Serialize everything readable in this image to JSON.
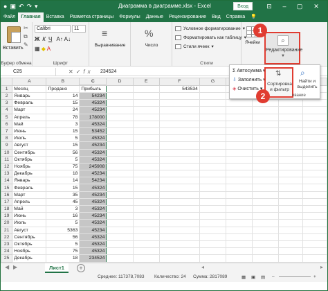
{
  "window": {
    "title": "Диаграмма в диаграмме.xlsx - Excel",
    "login": "Вход",
    "accent": "#217346",
    "highlight": "#e03c31"
  },
  "tabs": [
    "Файл",
    "Главная",
    "Вставка",
    "Разметка страницы",
    "Формулы",
    "Данные",
    "Рецензирование",
    "Вид",
    "Справка"
  ],
  "ribbon": {
    "paste_label": "Вставить",
    "clipboard_caption": "Буфер обмена",
    "font_name": "Calibri",
    "font_size": "11",
    "font_caption": "Шрифт",
    "align_label": "Выравнивание",
    "number_label": "Число",
    "cond_format": "Условное форматирование",
    "format_table": "Форматировать как таблицу",
    "cell_styles": "Стили ячеек",
    "styles_caption": "Стили",
    "cells_label": "Ячейки",
    "edit_label": "Редактирование"
  },
  "dropdown": {
    "autosum": "Автосумма",
    "fill": "Заполнить",
    "clear": "Очистить",
    "sort_filter": "Сортировка и фильтр",
    "find_select": "Найти и выделить",
    "caption": "ование"
  },
  "badges": [
    "1",
    "2"
  ],
  "formula_bar": {
    "name_box": "C25",
    "fx": "fx",
    "value": "234524"
  },
  "columns": [
    "A",
    "B",
    "C",
    "D",
    "E",
    "F",
    "G",
    "H",
    "I",
    "J",
    "K"
  ],
  "rows": [
    {
      "n": "1",
      "a": "Месяц",
      "b": "Продано",
      "c": "Прибыль",
      "f": "543534"
    },
    {
      "n": "2",
      "a": "Январь",
      "b": "14",
      "c": "54234"
    },
    {
      "n": "3",
      "a": "Февраль",
      "b": "15",
      "c": "45324"
    },
    {
      "n": "4",
      "a": "Март",
      "b": "24",
      "c": "45234"
    },
    {
      "n": "5",
      "a": "Апрель",
      "b": "78",
      "c": "178000"
    },
    {
      "n": "6",
      "a": "Май",
      "b": "3",
      "c": "45324"
    },
    {
      "n": "7",
      "a": "Июнь",
      "b": "15",
      "c": "53452"
    },
    {
      "n": "8",
      "a": "Июль",
      "b": "5",
      "c": "45324"
    },
    {
      "n": "9",
      "a": "Август",
      "b": "15",
      "c": "45234"
    },
    {
      "n": "10",
      "a": "Сентябрь",
      "b": "56",
      "c": "45324"
    },
    {
      "n": "11",
      "a": "Октябрь",
      "b": "5",
      "c": "45324"
    },
    {
      "n": "12",
      "a": "Ноябрь",
      "b": "75",
      "c": "245908"
    },
    {
      "n": "13",
      "a": "Декабрь",
      "b": "18",
      "c": "45234"
    },
    {
      "n": "14",
      "a": "Январь",
      "b": "14",
      "c": "54234"
    },
    {
      "n": "15",
      "a": "Февраль",
      "b": "15",
      "c": "45324"
    },
    {
      "n": "16",
      "a": "Март",
      "b": "35",
      "c": "45234"
    },
    {
      "n": "17",
      "a": "Апрель",
      "b": "45",
      "c": "45324"
    },
    {
      "n": "18",
      "a": "Май",
      "b": "3",
      "c": "45324"
    },
    {
      "n": "19",
      "a": "Июнь",
      "b": "16",
      "c": "45234"
    },
    {
      "n": "20",
      "a": "Июль",
      "b": "5",
      "c": "45324"
    },
    {
      "n": "21",
      "a": "Август",
      "b": "5363",
      "c": "45234"
    },
    {
      "n": "22",
      "a": "Сентябрь",
      "b": "56",
      "c": "45324"
    },
    {
      "n": "23",
      "a": "Октябрь",
      "b": "5",
      "c": "45324"
    },
    {
      "n": "24",
      "a": "Ноябрь",
      "b": "75",
      "c": "45324"
    },
    {
      "n": "25",
      "a": "Декабрь",
      "b": "18",
      "c": "234524"
    }
  ],
  "sheet_tab": "Лист1",
  "add_sheet": "+",
  "status": {
    "average": "Среднее: 117378,7083",
    "count": "Количество: 24",
    "sum": "Сумма: 2817089"
  }
}
